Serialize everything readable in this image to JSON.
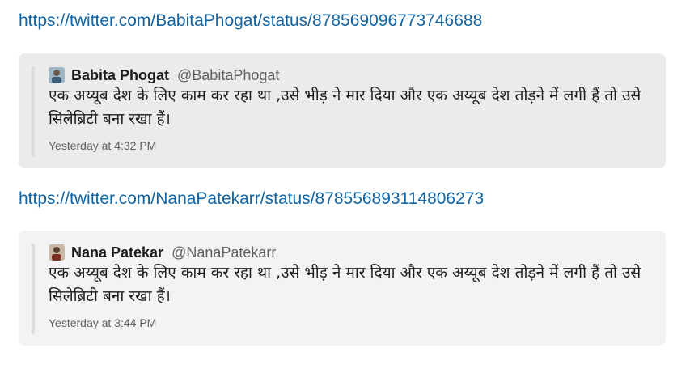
{
  "messages": [
    {
      "link": "https://twitter.com/BabitaPhogat/status/878569096773746688",
      "author": "Babita Phogat",
      "handle": "@BabitaPhogat",
      "text": "एक अय्यूब देश के लिए काम कर रहा था ,उसे भीड़ ने मार दिया और एक अय्यूब देश तोड़ने में लगी हैं तो उसे सिलेब्रिटी बना रखा हैं।",
      "timestamp": "Yesterday at 4:32 PM",
      "card_bg": "#ebebeb"
    },
    {
      "link": "https://twitter.com/NanaPatekarr/status/878556893114806273",
      "author": "Nana Patekar",
      "handle": "@NanaPatekarr",
      "text": "एक अय्यूब देश के लिए काम कर रहा था ,उसे भीड़ ने मार दिया और एक अय्यूब देश तोड़ने में लगी हैं तो उसे सिलेब्रिटी बना रखा हैं।",
      "timestamp": "Yesterday at 3:44 PM",
      "card_bg": "#f3f3f4"
    }
  ]
}
